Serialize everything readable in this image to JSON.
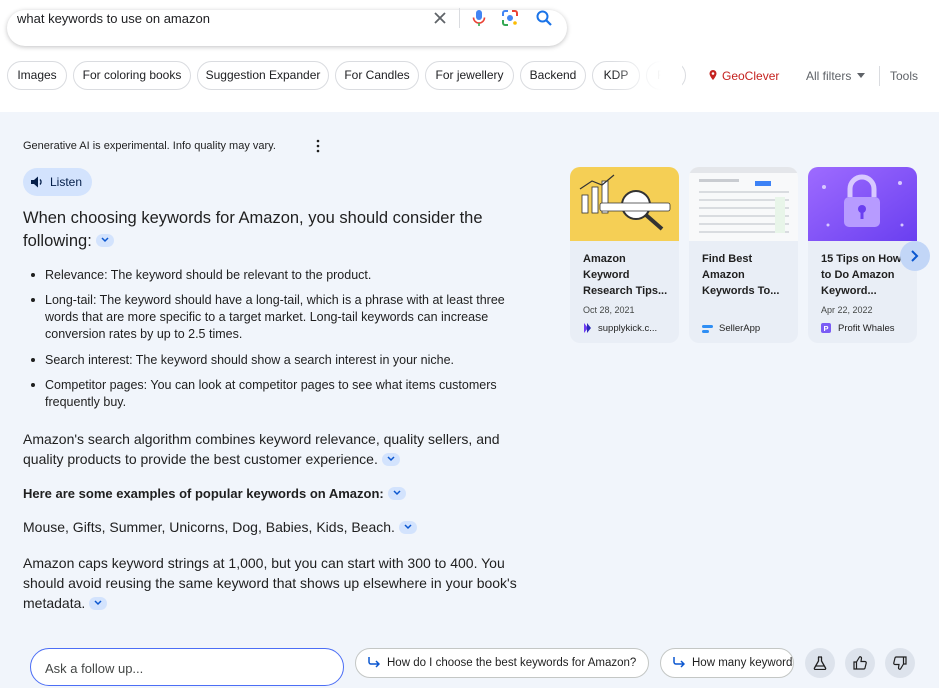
{
  "search": {
    "query": "what keywords to use on amazon"
  },
  "chips": [
    "Images",
    "For coloring books",
    "Suggestion Expander",
    "For Candles",
    "For jewellery",
    "Backend",
    "KDP",
    "F"
  ],
  "location": "GeoClever",
  "all_filters": "All filters",
  "tools": "Tools",
  "ai": {
    "disclaimer": "Generative AI is experimental. Info quality may vary.",
    "listen_label": "Listen",
    "heading": "When choosing keywords for Amazon, you should consider the following:",
    "bullets": [
      "Relevance: The keyword should be relevant to the product.",
      "Long-tail: The keyword should have a long-tail, which is a phrase with at least three words that are more specific to a target market. Long-tail keywords can increase conversion rates by up to 2.5 times.",
      "Search interest: The keyword should show a search interest in your niche.",
      "Competitor pages: You can look at competitor pages to see what items customers frequently buy."
    ],
    "para1": "Amazon's search algorithm combines keyword relevance, quality sellers, and quality products to provide the best customer experience.",
    "examples_heading": "Here are some examples of popular keywords on Amazon:",
    "examples": "Mouse, Gifts, Summer, Unicorns, Dog, Babies, Kids, Beach.",
    "para2": "Amazon caps keyword strings at 1,000, but you can start with 300 to 400. You should avoid reusing the same keyword that shows up elsewhere in your book's metadata."
  },
  "cards": [
    {
      "title": "Amazon Keyword Research Tips...",
      "date": "Oct 28, 2021",
      "source": "supplykick.c..."
    },
    {
      "title": "Find Best Amazon Keywords To...",
      "date": "",
      "source": "SellerApp"
    },
    {
      "title": "15 Tips on How to Do Amazon Keyword...",
      "date": "Apr 22, 2022",
      "source": "Profit Whales"
    }
  ],
  "followup": {
    "placeholder": "Ask a follow up...",
    "suggestions": [
      "How do I choose the best keywords for Amazon?",
      "How many keywords"
    ]
  },
  "colors": {
    "accent": "#1a73e8",
    "panel_bg": "#f1f5fb",
    "chip_blue": "#d3e3fd"
  }
}
